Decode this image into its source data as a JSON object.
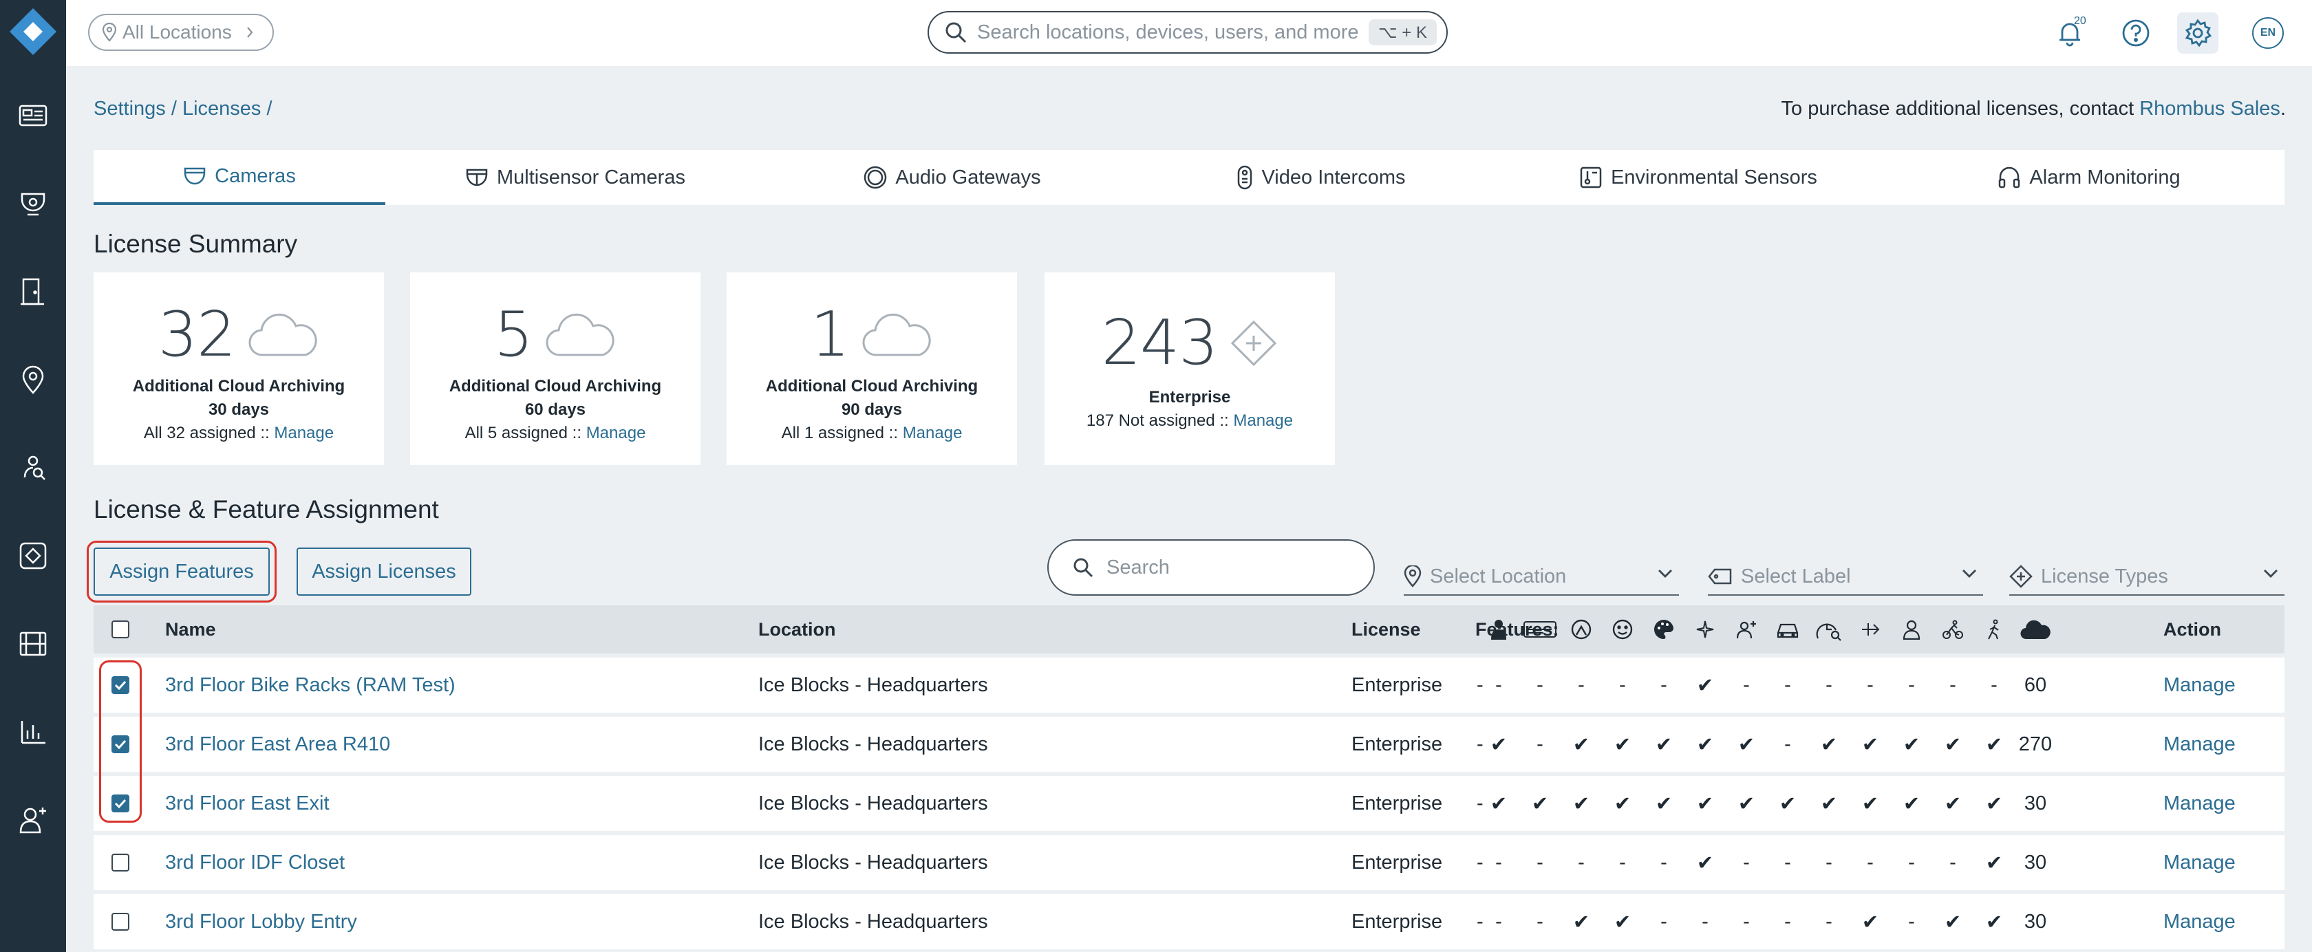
{
  "topbar": {
    "location_pill": "All Locations",
    "search_placeholder": "Search locations, devices, users, and more",
    "search_shortcut": "⌥ + K",
    "notification_count": "20",
    "language": "EN"
  },
  "breadcrumb": {
    "settings": "Settings",
    "sep1": " / ",
    "licenses": "Licenses",
    "sep2": " /"
  },
  "purchase": {
    "text": "To purchase additional licenses, contact ",
    "link": "Rhombus Sales",
    "end": "."
  },
  "tabs": [
    {
      "label": "Cameras",
      "icon": "camera-dome-icon"
    },
    {
      "label": "Multisensor Cameras",
      "icon": "multisensor-camera-icon"
    },
    {
      "label": "Audio Gateways",
      "icon": "audio-gateway-icon"
    },
    {
      "label": "Video Intercoms",
      "icon": "intercom-icon"
    },
    {
      "label": "Environmental Sensors",
      "icon": "environmental-sensor-icon"
    },
    {
      "label": "Alarm Monitoring",
      "icon": "headset-icon"
    }
  ],
  "summary": {
    "title": "License Summary",
    "cards": [
      {
        "count": "32",
        "line1": "Additional Cloud Archiving",
        "line2": "30 days",
        "status": "All 32 assigned :: ",
        "link": "Manage",
        "icon": "cloud-icon"
      },
      {
        "count": "5",
        "line1": "Additional Cloud Archiving",
        "line2": "60 days",
        "status": "All 5 assigned :: ",
        "link": "Manage",
        "icon": "cloud-icon"
      },
      {
        "count": "1",
        "line1": "Additional Cloud Archiving",
        "line2": "90 days",
        "status": "All 1 assigned :: ",
        "link": "Manage",
        "icon": "cloud-icon"
      },
      {
        "count": "243",
        "line1": "Enterprise",
        "line2": "",
        "status": "187 Not assigned :: ",
        "link": "Manage",
        "icon": "diamond-plus-icon"
      }
    ]
  },
  "assignment": {
    "title": "License & Feature Assignment",
    "assign_features": "Assign Features",
    "assign_licenses": "Assign Licenses",
    "search_placeholder": "Search",
    "select_location": "Select Location",
    "select_label": "Select Label",
    "license_types": "License Types"
  },
  "table": {
    "headers": {
      "name": "Name",
      "location": "Location",
      "license": "License",
      "features": "Features:",
      "action": "Action"
    },
    "feature_icons": [
      "person-badge-icon",
      "license-plate-icon",
      "face-outline-icon",
      "face-detect-icon",
      "color-palette-icon",
      "sparkle-icon",
      "person-add-icon",
      "vehicle-icon",
      "clock-search-icon",
      "motion-arrow-icon",
      "person-icon",
      "cyclist-icon",
      "walker-icon",
      "cloud-filled-icon"
    ],
    "rows": [
      {
        "checked": true,
        "name": "3rd Floor Bike Racks (RAM Test)",
        "location": "Ice Blocks - Headquarters",
        "license": "Enterprise",
        "features": "-",
        "flags": [
          "-",
          "-",
          "-",
          "-",
          "-",
          "✔",
          "-",
          "-",
          "-",
          "-",
          "-",
          "-",
          "-"
        ],
        "cloud": "60",
        "action": "Manage"
      },
      {
        "checked": true,
        "name": "3rd Floor East Area R410",
        "location": "Ice Blocks - Headquarters",
        "license": "Enterprise",
        "features": "-",
        "flags": [
          "✔",
          "-",
          "✔",
          "✔",
          "✔",
          "✔",
          "✔",
          "-",
          "✔",
          "✔",
          "✔",
          "✔",
          "✔"
        ],
        "cloud": "270",
        "action": "Manage"
      },
      {
        "checked": true,
        "name": "3rd Floor East Exit",
        "location": "Ice Blocks - Headquarters",
        "license": "Enterprise",
        "features": "-",
        "flags": [
          "✔",
          "✔",
          "✔",
          "✔",
          "✔",
          "✔",
          "✔",
          "✔",
          "✔",
          "✔",
          "✔",
          "✔",
          "✔"
        ],
        "cloud": "30",
        "action": "Manage"
      },
      {
        "checked": false,
        "name": "3rd Floor IDF Closet",
        "location": "Ice Blocks - Headquarters",
        "license": "Enterprise",
        "features": "-",
        "flags": [
          "-",
          "-",
          "-",
          "-",
          "-",
          "✔",
          "-",
          "-",
          "-",
          "-",
          "-",
          "-",
          "✔"
        ],
        "cloud": "30",
        "action": "Manage"
      },
      {
        "checked": false,
        "name": "3rd Floor Lobby Entry",
        "location": "Ice Blocks - Headquarters",
        "license": "Enterprise",
        "features": "-",
        "flags": [
          "-",
          "-",
          "✔",
          "✔",
          "-",
          "-",
          "-",
          "-",
          "-",
          "✔",
          "-",
          "✔",
          "✔"
        ],
        "cloud": "30",
        "action": "Manage"
      }
    ]
  },
  "colors": {
    "accent": "#2b6d92",
    "sidebar": "#20313d",
    "highlight": "#d9342b",
    "logo": "#3a8fd1"
  }
}
